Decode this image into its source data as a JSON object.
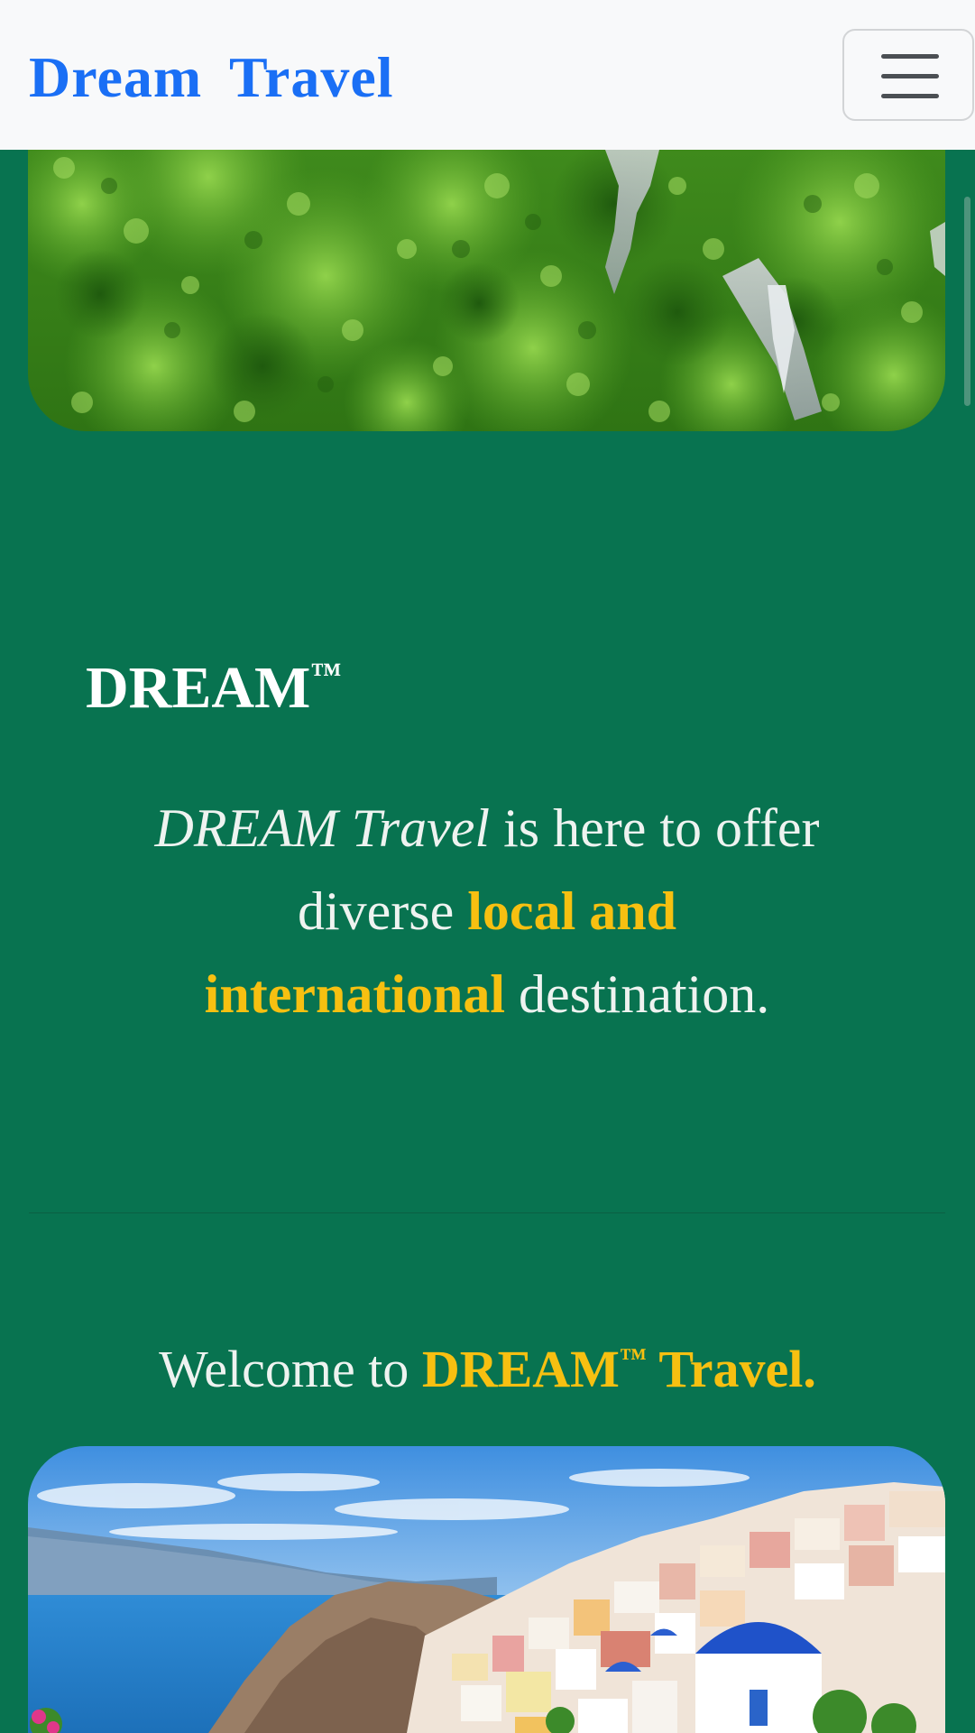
{
  "navbar": {
    "brand": "Dream  Travel",
    "toggle_icon": "hamburger-menu-icon"
  },
  "images": {
    "top": "forest-waterfall-photo",
    "bottom": "santorini-village-photo"
  },
  "about": {
    "heading": "DREAM",
    "heading_tm": "™",
    "intro_italic": "DREAM Travel",
    "intro_line1_rest": " is here to offer diverse ",
    "intro_highlight": "local and international",
    "intro_end": " destination."
  },
  "welcome": {
    "prefix": "Welcome to ",
    "brand": "DREAM",
    "tm": "™",
    "brand_rest": " Travel."
  },
  "colors": {
    "background": "#087350",
    "brand_blue": "#1a6ff5",
    "highlight": "#f7c011",
    "navbar_bg": "#f8f9fa"
  }
}
